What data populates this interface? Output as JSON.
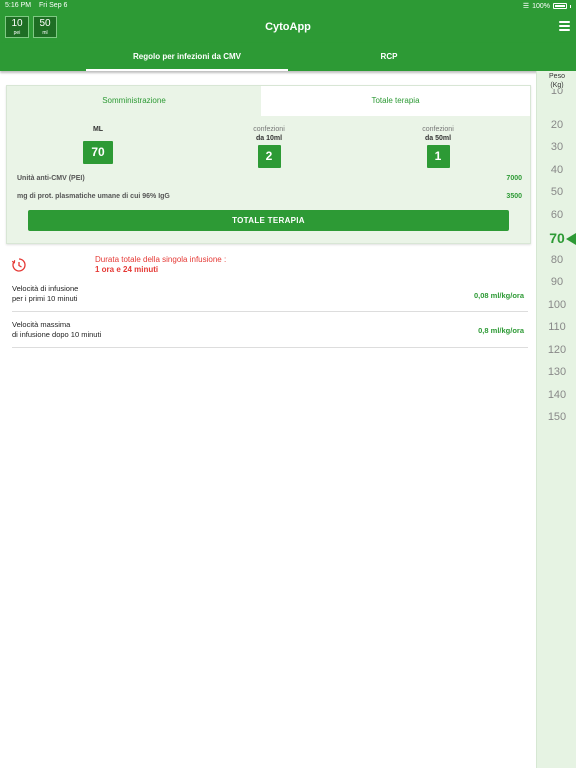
{
  "status": {
    "time": "5:16 PM",
    "date": "Fri Sep 6",
    "battery": "100%"
  },
  "header": {
    "title": "CytoApp",
    "mini_boxes": [
      {
        "value": "10",
        "unit": "pei"
      },
      {
        "value": "50",
        "unit": "ml"
      }
    ]
  },
  "tabs": [
    {
      "label": "Regolo per infezioni da CMV",
      "active": true
    },
    {
      "label": "RCP",
      "active": false
    }
  ],
  "weight": {
    "header_line1": "Peso",
    "header_line2": "(Kg)",
    "values": [
      "10",
      "20",
      "30",
      "40",
      "50",
      "60",
      "70",
      "80",
      "90",
      "100",
      "110",
      "120",
      "130",
      "140",
      "150"
    ],
    "selected": "70"
  },
  "card": {
    "tabs": [
      {
        "label": "Somministrazione",
        "active": true
      },
      {
        "label": "Totale terapia",
        "active": false
      }
    ],
    "columns": [
      {
        "label": "ML",
        "sublabel": "",
        "value": "70"
      },
      {
        "label": "confezioni",
        "sublabel": "da 10ml",
        "value": "2"
      },
      {
        "label": "confezioni",
        "sublabel": "da 50ml",
        "value": "1"
      }
    ],
    "info": [
      {
        "label": "Unità anti-CMV (PEI)",
        "value": "7000"
      },
      {
        "label": "mg di prot. plasmatiche umane di cui 96% IgG",
        "value": "3500"
      }
    ],
    "button": "TOTALE TERAPIA"
  },
  "duration": {
    "label": "Durata totale della singola infusione :",
    "value": "1 ora e 24 minuti"
  },
  "rows": [
    {
      "line1": "Velocità di infusione",
      "line2": "per i primi 10 minuti",
      "value": "0,08 ml/kg/ora"
    },
    {
      "line1": "Velocità massima",
      "line2": "di infusione dopo 10 minuti",
      "value": "0,8 ml/kg/ora"
    }
  ],
  "colors": {
    "primary": "#2d9a35",
    "alert": "#e53935",
    "sidebar": "#e6f3e3",
    "card": "#eaf4e7"
  }
}
